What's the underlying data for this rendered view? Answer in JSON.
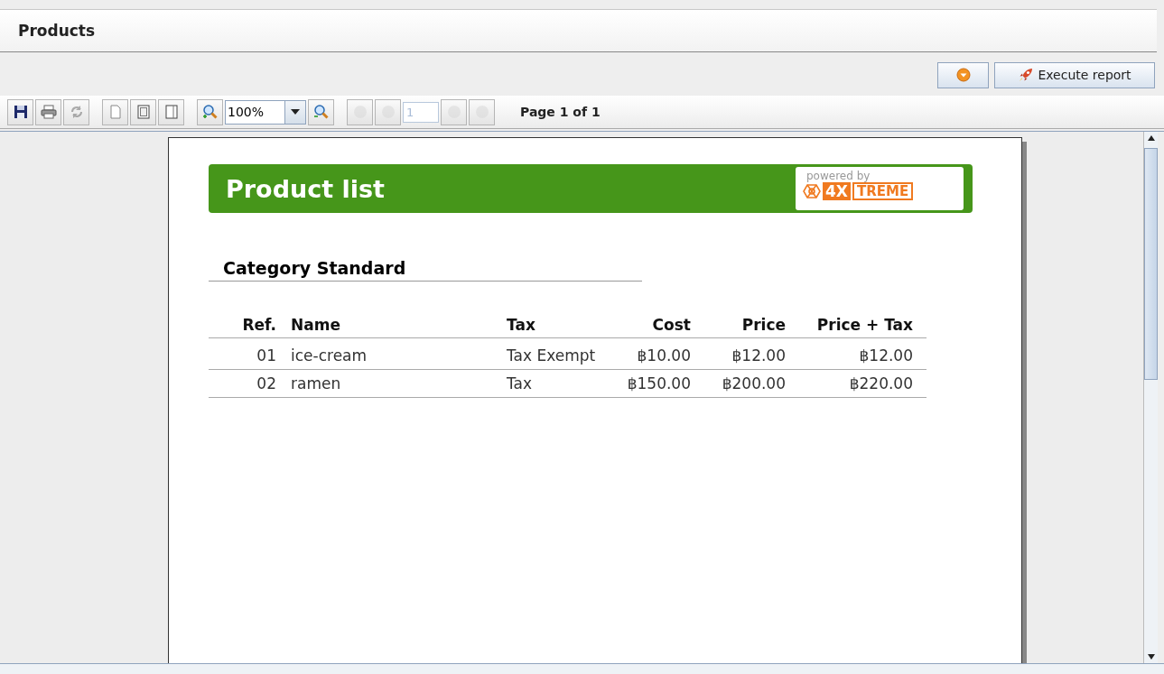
{
  "window": {
    "title": "Products"
  },
  "actions": {
    "menu_button": {
      "disabled": false
    },
    "execute_button": {
      "label": "Execute report"
    }
  },
  "toolbar": {
    "save": {
      "disabled": false
    },
    "print": {
      "disabled": false
    },
    "refresh": {
      "disabled": true
    },
    "zoom": {
      "value": "100%"
    },
    "first_page": {
      "disabled": true
    },
    "previous_page": {
      "disabled": true
    },
    "page_field": {
      "value": "1",
      "disabled": true
    },
    "next_page": {
      "disabled": true
    },
    "last_page": {
      "disabled": true
    },
    "page_label": "Page 1 of 1"
  },
  "report": {
    "title": "Product list",
    "logo": {
      "tagline": "powered by",
      "brand_left": "4X",
      "brand_right": "TREME"
    },
    "group_header": "Category Standard",
    "columns": [
      "Ref.",
      "Name",
      "Tax",
      "Cost",
      "Price",
      "Price + Tax"
    ],
    "rows": [
      {
        "ref": "01",
        "name": "ice-cream",
        "tax": "Tax Exempt",
        "cost": "฿10.00",
        "price": "฿12.00",
        "price_tax": "฿12.00"
      },
      {
        "ref": "02",
        "name": "ramen",
        "tax": "Tax",
        "cost": "฿150.00",
        "price": "฿200.00",
        "price_tax": "฿220.00"
      }
    ]
  }
}
